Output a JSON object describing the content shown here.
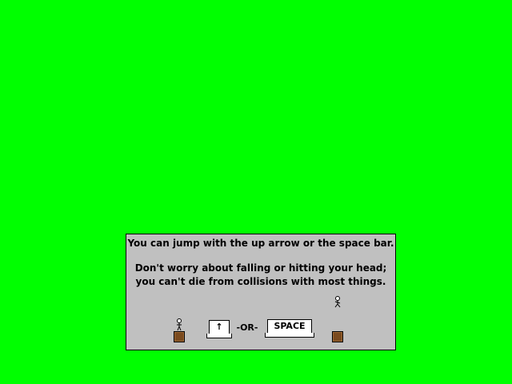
{
  "tutorial": {
    "line1": "You can jump with the up arrow or the space bar.",
    "line2": "Don't worry about falling or hitting your head;",
    "line3": "you can't die from collisions with most things.",
    "up_key_label": "↑",
    "or_label": "-OR-",
    "space_key_label": "SPACE"
  },
  "colors": {
    "background": "#00ff00",
    "panel": "#c0c0c0",
    "crate": "#7a4a1e"
  }
}
